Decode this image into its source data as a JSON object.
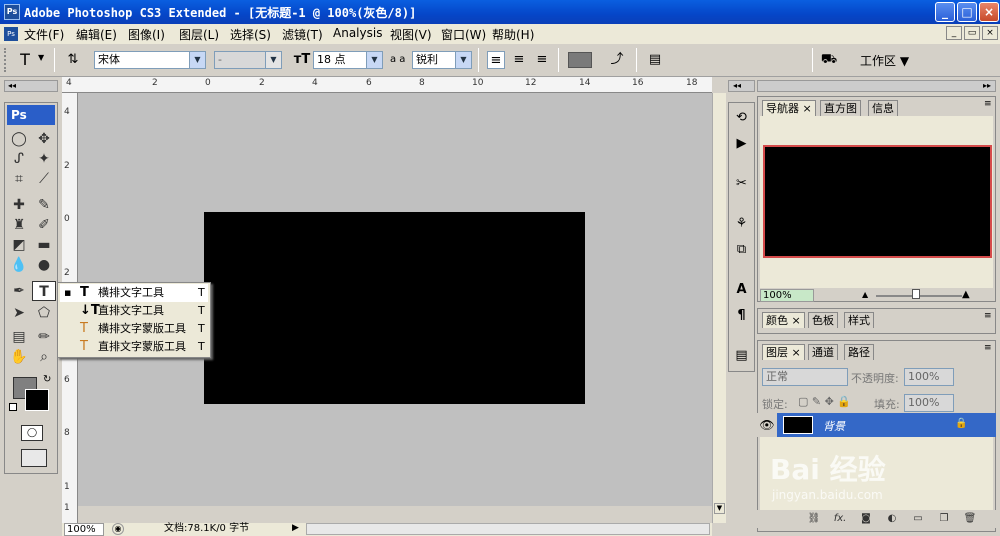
{
  "app": {
    "title": "Adobe Photoshop CS3 Extended - [无标题-1 @ 100%(灰色/8)]",
    "logo": "Ps"
  },
  "window_buttons": {
    "min": "_",
    "max": "□",
    "close": "×"
  },
  "menu": [
    "文件(F)",
    "编辑(E)",
    "图像(I)",
    "图层(L)",
    "选择(S)",
    "滤镜(T)",
    "Analysis",
    "视图(V)",
    "窗口(W)",
    "帮助(H)"
  ],
  "options": {
    "tool_icon": "T",
    "font_family": "宋体",
    "font_style": "-",
    "font_size": "18 点",
    "aa_label": "a a",
    "antialias": "锐利",
    "workspace": "工作区 ▼"
  },
  "ruler_h": [
    "4",
    "2",
    "0",
    "2",
    "4",
    "6",
    "8",
    "10",
    "12",
    "14",
    "16",
    "18"
  ],
  "ruler_v": [
    "4",
    "2",
    "0",
    "2",
    "4",
    "6",
    "8",
    "1",
    "1"
  ],
  "toolbox": {
    "logo": "Ps"
  },
  "flyout": [
    {
      "label": "横排文字工具",
      "key": "T",
      "active": true
    },
    {
      "label": "直排文字工具",
      "key": "T",
      "active": false
    },
    {
      "label": "横排文字蒙版工具",
      "key": "T",
      "active": false
    },
    {
      "label": "直排文字蒙版工具",
      "key": "T",
      "active": false
    }
  ],
  "status": {
    "zoom": "100%",
    "doc": "文档:78.1K/0 字节"
  },
  "navigator": {
    "tabs": [
      "导航器",
      "直方图",
      "信息"
    ],
    "zoom": "100%"
  },
  "color_panel": {
    "tabs": [
      "颜色",
      "色板",
      "样式"
    ]
  },
  "layers": {
    "tabs": [
      "图层",
      "通道",
      "路径"
    ],
    "blend_mode": "正常",
    "opacity_label": "不透明度:",
    "opacity": "100%",
    "lock_label": "锁定:",
    "fill_label": "填充:",
    "fill": "100%",
    "layer_name": "背景"
  },
  "watermark": {
    "text": "Bai 经验",
    "url": "jingyan.baidu.com"
  }
}
